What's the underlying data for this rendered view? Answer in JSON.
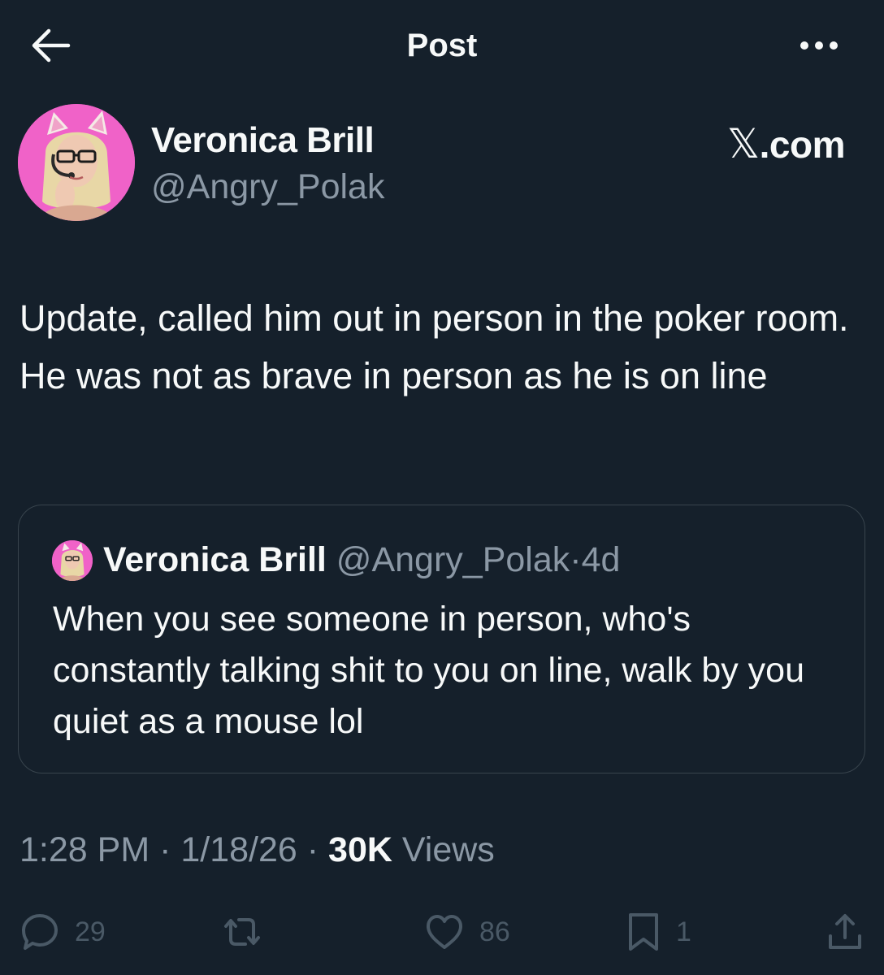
{
  "header": {
    "title": "Post",
    "back_icon": "arrow-left-icon",
    "more_icon": "more-horizontal-icon"
  },
  "author": {
    "name": "Veronica Brill",
    "handle": "@Angry_Polak",
    "avatar_bg": "#f062c8"
  },
  "watermark": {
    "x": "𝕏",
    "domain": ".com"
  },
  "post": {
    "text": "Update, called him out in person in the poker room. He was not as brave in person as he is on line"
  },
  "quote": {
    "name": "Veronica Brill",
    "handle": "@Angry_Polak",
    "separator": "·",
    "time": "4d",
    "text": "When you see someone in person, who's constantly talking shit to you on line, walk by you quiet as a mouse lol"
  },
  "meta": {
    "time": "1:28 PM",
    "sep1": " · ",
    "date": "1/18/26",
    "sep2": " · ",
    "views_count": "30K",
    "views_label": " Views"
  },
  "actions": {
    "replies": "29",
    "reposts": "",
    "likes": "86",
    "bookmarks": "1"
  },
  "colors": {
    "background": "#15202b",
    "text": "#f7f9f9",
    "secondary": "#8b98a5",
    "border": "#38444d",
    "action": "#4a5966"
  }
}
